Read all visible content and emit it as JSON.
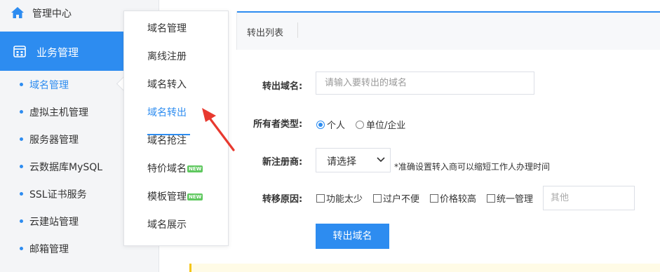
{
  "sidebar": {
    "home_label": "管理中心",
    "section_label": "业务管理",
    "items": [
      {
        "label": "域名管理",
        "active": true
      },
      {
        "label": "虚拟主机管理"
      },
      {
        "label": "服务器管理"
      },
      {
        "label": "云数据库MySQL"
      },
      {
        "label": "SSL证书服务"
      },
      {
        "label": "云建站管理"
      },
      {
        "label": "邮箱管理"
      }
    ]
  },
  "submenu": {
    "items": [
      {
        "label": "域名管理"
      },
      {
        "label": "离线注册"
      },
      {
        "label": "域名转入"
      },
      {
        "label": "域名转出",
        "active": true
      },
      {
        "label": "域名抢注"
      },
      {
        "label": "特价域名",
        "badge": "NEW"
      },
      {
        "label": "模板管理",
        "badge": "NEW"
      },
      {
        "label": "域名展示"
      }
    ]
  },
  "tabs": {
    "active_label": "转出列表"
  },
  "form": {
    "domain_label": "转出域名:",
    "domain_placeholder": "请输入要转出的域名",
    "owner_label": "所有者类型:",
    "owner_options": [
      "个人",
      "单位/企业"
    ],
    "owner_selected": "个人",
    "registrar_label": "新注册商:",
    "registrar_value": "请选择",
    "registrar_hint": "*准确设置转入商可以缩短工作人办理时间",
    "reason_label": "转移原因:",
    "reasons": [
      "功能太少",
      "过户不便",
      "价格较高",
      "统一管理"
    ],
    "other_placeholder": "其他",
    "submit_label": "转出域名"
  },
  "colors": {
    "accent": "#2d8cf0",
    "annotation_arrow": "#e8392f",
    "new_badge": "#5fc85f"
  }
}
